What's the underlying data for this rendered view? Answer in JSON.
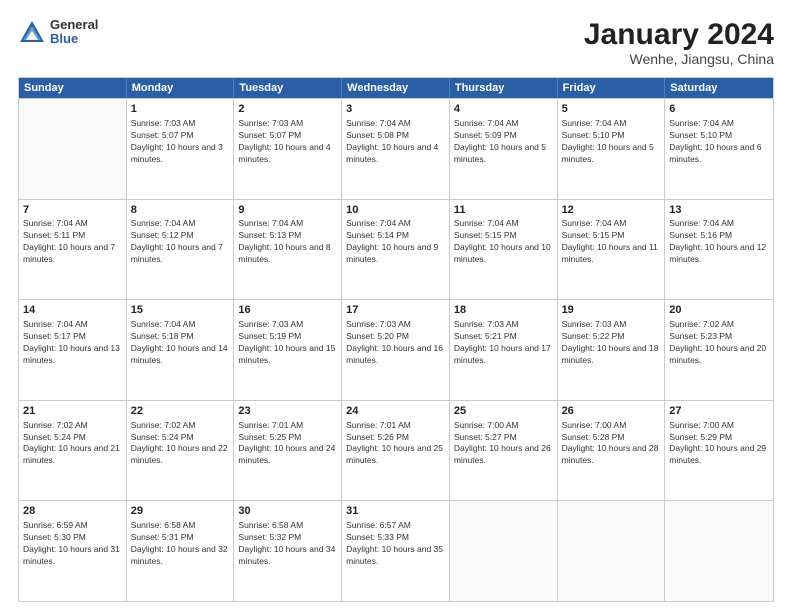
{
  "header": {
    "logo": {
      "general": "General",
      "blue": "Blue"
    },
    "title": "January 2024",
    "location": "Wenhe, Jiangsu, China"
  },
  "weekdays": [
    "Sunday",
    "Monday",
    "Tuesday",
    "Wednesday",
    "Thursday",
    "Friday",
    "Saturday"
  ],
  "rows": [
    [
      {
        "day": "",
        "empty": true
      },
      {
        "day": "1",
        "sunrise": "Sunrise: 7:03 AM",
        "sunset": "Sunset: 5:07 PM",
        "daylight": "Daylight: 10 hours and 3 minutes."
      },
      {
        "day": "2",
        "sunrise": "Sunrise: 7:03 AM",
        "sunset": "Sunset: 5:07 PM",
        "daylight": "Daylight: 10 hours and 4 minutes."
      },
      {
        "day": "3",
        "sunrise": "Sunrise: 7:04 AM",
        "sunset": "Sunset: 5:08 PM",
        "daylight": "Daylight: 10 hours and 4 minutes."
      },
      {
        "day": "4",
        "sunrise": "Sunrise: 7:04 AM",
        "sunset": "Sunset: 5:09 PM",
        "daylight": "Daylight: 10 hours and 5 minutes."
      },
      {
        "day": "5",
        "sunrise": "Sunrise: 7:04 AM",
        "sunset": "Sunset: 5:10 PM",
        "daylight": "Daylight: 10 hours and 5 minutes."
      },
      {
        "day": "6",
        "sunrise": "Sunrise: 7:04 AM",
        "sunset": "Sunset: 5:10 PM",
        "daylight": "Daylight: 10 hours and 6 minutes."
      }
    ],
    [
      {
        "day": "7",
        "sunrise": "Sunrise: 7:04 AM",
        "sunset": "Sunset: 5:11 PM",
        "daylight": "Daylight: 10 hours and 7 minutes."
      },
      {
        "day": "8",
        "sunrise": "Sunrise: 7:04 AM",
        "sunset": "Sunset: 5:12 PM",
        "daylight": "Daylight: 10 hours and 7 minutes."
      },
      {
        "day": "9",
        "sunrise": "Sunrise: 7:04 AM",
        "sunset": "Sunset: 5:13 PM",
        "daylight": "Daylight: 10 hours and 8 minutes."
      },
      {
        "day": "10",
        "sunrise": "Sunrise: 7:04 AM",
        "sunset": "Sunset: 5:14 PM",
        "daylight": "Daylight: 10 hours and 9 minutes."
      },
      {
        "day": "11",
        "sunrise": "Sunrise: 7:04 AM",
        "sunset": "Sunset: 5:15 PM",
        "daylight": "Daylight: 10 hours and 10 minutes."
      },
      {
        "day": "12",
        "sunrise": "Sunrise: 7:04 AM",
        "sunset": "Sunset: 5:15 PM",
        "daylight": "Daylight: 10 hours and 11 minutes."
      },
      {
        "day": "13",
        "sunrise": "Sunrise: 7:04 AM",
        "sunset": "Sunset: 5:16 PM",
        "daylight": "Daylight: 10 hours and 12 minutes."
      }
    ],
    [
      {
        "day": "14",
        "sunrise": "Sunrise: 7:04 AM",
        "sunset": "Sunset: 5:17 PM",
        "daylight": "Daylight: 10 hours and 13 minutes."
      },
      {
        "day": "15",
        "sunrise": "Sunrise: 7:04 AM",
        "sunset": "Sunset: 5:18 PM",
        "daylight": "Daylight: 10 hours and 14 minutes."
      },
      {
        "day": "16",
        "sunrise": "Sunrise: 7:03 AM",
        "sunset": "Sunset: 5:19 PM",
        "daylight": "Daylight: 10 hours and 15 minutes."
      },
      {
        "day": "17",
        "sunrise": "Sunrise: 7:03 AM",
        "sunset": "Sunset: 5:20 PM",
        "daylight": "Daylight: 10 hours and 16 minutes."
      },
      {
        "day": "18",
        "sunrise": "Sunrise: 7:03 AM",
        "sunset": "Sunset: 5:21 PM",
        "daylight": "Daylight: 10 hours and 17 minutes."
      },
      {
        "day": "19",
        "sunrise": "Sunrise: 7:03 AM",
        "sunset": "Sunset: 5:22 PM",
        "daylight": "Daylight: 10 hours and 18 minutes."
      },
      {
        "day": "20",
        "sunrise": "Sunrise: 7:02 AM",
        "sunset": "Sunset: 5:23 PM",
        "daylight": "Daylight: 10 hours and 20 minutes."
      }
    ],
    [
      {
        "day": "21",
        "sunrise": "Sunrise: 7:02 AM",
        "sunset": "Sunset: 5:24 PM",
        "daylight": "Daylight: 10 hours and 21 minutes."
      },
      {
        "day": "22",
        "sunrise": "Sunrise: 7:02 AM",
        "sunset": "Sunset: 5:24 PM",
        "daylight": "Daylight: 10 hours and 22 minutes."
      },
      {
        "day": "23",
        "sunrise": "Sunrise: 7:01 AM",
        "sunset": "Sunset: 5:25 PM",
        "daylight": "Daylight: 10 hours and 24 minutes."
      },
      {
        "day": "24",
        "sunrise": "Sunrise: 7:01 AM",
        "sunset": "Sunset: 5:26 PM",
        "daylight": "Daylight: 10 hours and 25 minutes."
      },
      {
        "day": "25",
        "sunrise": "Sunrise: 7:00 AM",
        "sunset": "Sunset: 5:27 PM",
        "daylight": "Daylight: 10 hours and 26 minutes."
      },
      {
        "day": "26",
        "sunrise": "Sunrise: 7:00 AM",
        "sunset": "Sunset: 5:28 PM",
        "daylight": "Daylight: 10 hours and 28 minutes."
      },
      {
        "day": "27",
        "sunrise": "Sunrise: 7:00 AM",
        "sunset": "Sunset: 5:29 PM",
        "daylight": "Daylight: 10 hours and 29 minutes."
      }
    ],
    [
      {
        "day": "28",
        "sunrise": "Sunrise: 6:59 AM",
        "sunset": "Sunset: 5:30 PM",
        "daylight": "Daylight: 10 hours and 31 minutes."
      },
      {
        "day": "29",
        "sunrise": "Sunrise: 6:58 AM",
        "sunset": "Sunset: 5:31 PM",
        "daylight": "Daylight: 10 hours and 32 minutes."
      },
      {
        "day": "30",
        "sunrise": "Sunrise: 6:58 AM",
        "sunset": "Sunset: 5:32 PM",
        "daylight": "Daylight: 10 hours and 34 minutes."
      },
      {
        "day": "31",
        "sunrise": "Sunrise: 6:57 AM",
        "sunset": "Sunset: 5:33 PM",
        "daylight": "Daylight: 10 hours and 35 minutes."
      },
      {
        "day": "",
        "empty": true
      },
      {
        "day": "",
        "empty": true
      },
      {
        "day": "",
        "empty": true
      }
    ]
  ]
}
